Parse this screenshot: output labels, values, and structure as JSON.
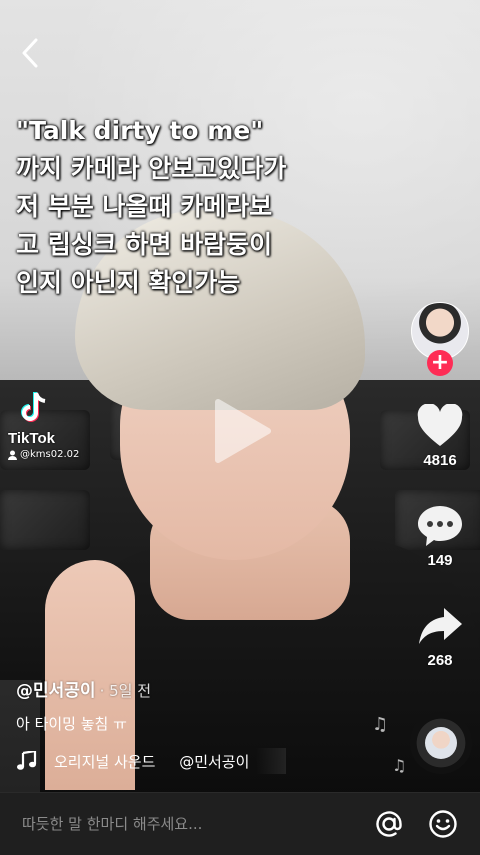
{
  "overlay": {
    "lines": [
      "\"Talk dirty to me\"",
      "까지 카메라 안보고있다가",
      "저 부분 나올때 카메라보",
      "고 립싱크 하면 바람둥이",
      "인지 아닌지 확인가능"
    ]
  },
  "watermark": {
    "brand": "TikTok",
    "user": "@kms02.02"
  },
  "actions": {
    "likes": "4816",
    "comments": "149",
    "shares": "268"
  },
  "post": {
    "author": "@민서공이",
    "date": "· 5일 전",
    "caption": "아 타이밍 놓침 ㅠ",
    "sound": "오리지널 사운드     @민서공이"
  },
  "comment_bar": {
    "placeholder": "따듯한 말 한마디 해주세요..."
  },
  "icons": {
    "back": "chevron-left-icon",
    "like": "heart-icon",
    "comment": "comment-bubble-icon",
    "share": "share-arrow-icon",
    "music": "music-note-icon",
    "mention": "at-sign-icon",
    "emoji": "smile-icon"
  },
  "colors": {
    "follow_badge": "#fe2c55",
    "comment_bar_bg": "#1f1f1f"
  }
}
